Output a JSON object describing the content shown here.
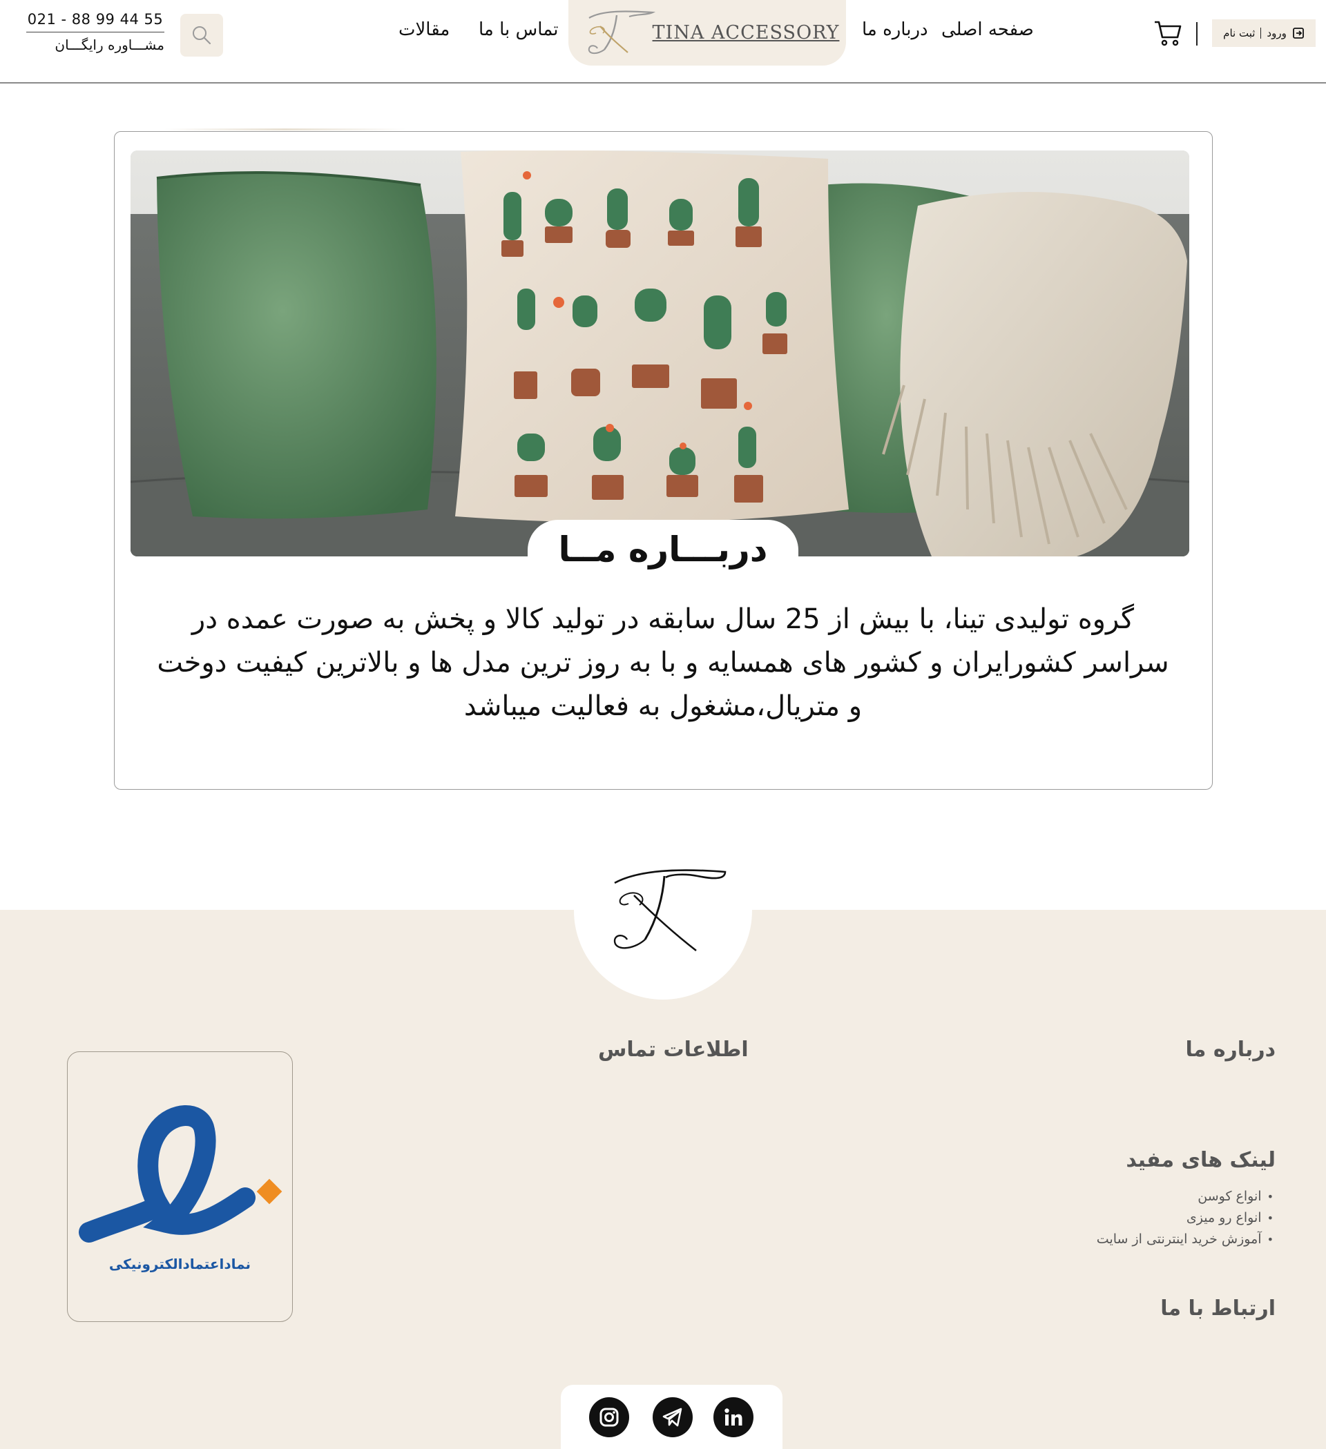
{
  "header": {
    "phone": "021 - 88 99 44 55",
    "consult_label": "مشـــاوره رایگـــان",
    "nav": {
      "home": "صفحه اصلی",
      "about": "درباره ما",
      "contact": "تماس با ما",
      "articles": "مقالات"
    },
    "logo_text": "TINA ACCESSORY",
    "login": {
      "login_label": "ورود",
      "register_label": "ثبت نام"
    }
  },
  "about_section": {
    "title": "دربـــاره مــا",
    "text": "گروه تولیدی تینا، با بیش از 25 سال سابقه در تولید کالا و پخش به صورت عمده در سراسر کشورایران و کشور های همسایه و با به روز ترین مدل ها و بالاترین کیفیت دوخت و متریال،مشغول به فعالیت میباشد"
  },
  "footer": {
    "about_heading": "درباره ما",
    "contact_info_heading": "اطلاعات تماس",
    "useful_links_heading": "لینک های مفید",
    "useful_links": [
      "انواع کوسن",
      "انواع رو میزی",
      "آموزش خرید اینترنتی از سایت"
    ],
    "connect_heading": "ارتباط با ما",
    "enamad_caption": "نماداعتمادالکترونیکی",
    "social": [
      "instagram-icon",
      "telegram-icon",
      "linkedin-icon"
    ]
  },
  "colors": {
    "cream": "#f3ede4",
    "text_dark": "#111111",
    "footer_text": "#555555",
    "enamad_blue": "#1b57a3",
    "enamad_orange": "#ef8d22"
  }
}
